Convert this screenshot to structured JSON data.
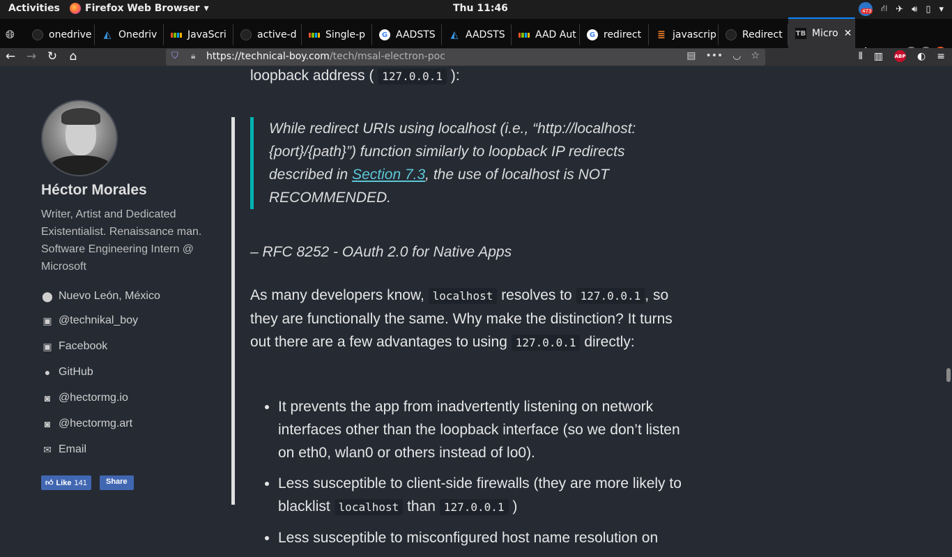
{
  "topbar": {
    "activities": "Activities",
    "app_name": "Firefox Web Browser",
    "clock": "Thu 11:46",
    "notification_count": "473"
  },
  "tabs": [
    {
      "title": "onedrive",
      "icon": "github-icon"
    },
    {
      "title": "Onedriv",
      "icon": "azure-icon"
    },
    {
      "title": "JavaScri",
      "icon": "microsoft-icon"
    },
    {
      "title": "active-d",
      "icon": "github-icon"
    },
    {
      "title": "Single-p",
      "icon": "microsoft-icon"
    },
    {
      "title": "AADSTS",
      "icon": "google-icon"
    },
    {
      "title": "AADSTS",
      "icon": "azure-icon"
    },
    {
      "title": "AAD Aut",
      "icon": "microsoft-icon"
    },
    {
      "title": "redirect",
      "icon": "google-icon"
    },
    {
      "title": "javascrip",
      "icon": "stackoverflow-icon"
    },
    {
      "title": "Redirect",
      "icon": "github-icon"
    },
    {
      "title": "Micro",
      "icon": "tb-icon",
      "active": true
    }
  ],
  "navbar": {
    "url_host": "https://technical-boy.com",
    "url_path": "/tech/msal-electron-poc"
  },
  "sidebar": {
    "name": "Héctor Morales",
    "bio": "Writer, Artist and Dedicated Existentialist. Renaissance man. Software Engineering Intern @ Microsoft",
    "links": [
      {
        "label": "Nuevo León, México",
        "icon": "location-icon"
      },
      {
        "label": "@technikal_boy",
        "icon": "twitter-icon"
      },
      {
        "label": "Facebook",
        "icon": "facebook-icon"
      },
      {
        "label": "GitHub",
        "icon": "github-icon"
      },
      {
        "label": "@hectormg.io",
        "icon": "instagram-icon"
      },
      {
        "label": "@hectormg.art",
        "icon": "instagram-icon"
      },
      {
        "label": "Email",
        "icon": "email-icon"
      }
    ],
    "fb_like": "Like",
    "fb_like_count": "141",
    "fb_share": "Share"
  },
  "article": {
    "loop_text": "loopback address (",
    "loop_code": "127.0.0.1",
    "loop_end": "):",
    "quote_pre": "While redirect URIs using localhost (i.e., “http://localhost:{port}/{path}”) function similarly to loopback IP redirects described in ",
    "quote_link": "Section 7.3",
    "quote_post": ", the use of localhost is NOT RECOMMENDED.",
    "attribution": "– RFC 8252 - OAuth 2.0 for Native Apps",
    "p1_a": "As many developers know,",
    "p1_code1": "localhost",
    "p1_b": "resolves to",
    "p1_code2": "127.0.0.1",
    "p1_c": ", so they are functionally the same. Why make the distinction? It turns out there are a few advantages to using",
    "p1_code3": "127.0.0.1",
    "p1_d": "directly:",
    "bullet1": "It prevents the app from inadvertently listening on network interfaces other than the loopback interface (so we don’t listen on eth0, wlan0 or others instead of lo0).",
    "bullet2_a": "Less susceptible to client-side firewalls (they are more likely to blacklist",
    "bullet2_code1": "localhost",
    "bullet2_b": "than",
    "bullet2_code2": "127.0.0.1",
    "bullet2_c": ")",
    "bullet3": "Less susceptible to misconfigured host name resolution on"
  }
}
